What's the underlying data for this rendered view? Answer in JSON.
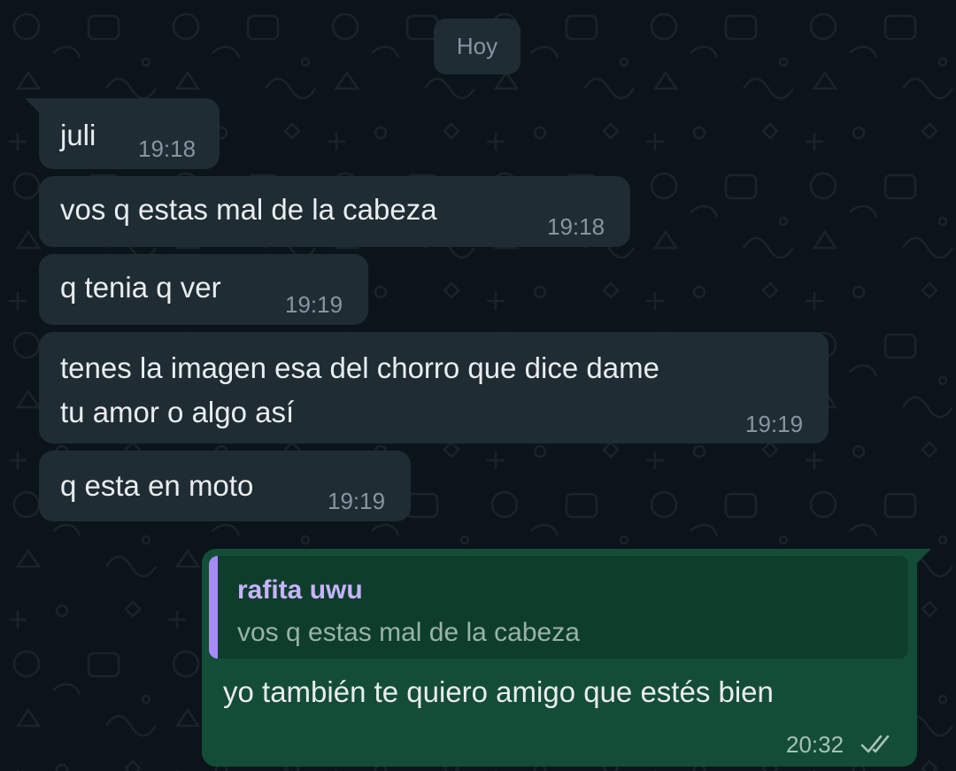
{
  "date_chip": "Hoy",
  "incoming": [
    {
      "text": "juli",
      "time": "19:18"
    },
    {
      "text": "vos q estas mal de la cabeza",
      "time": "19:18"
    },
    {
      "text": "q tenia q ver",
      "time": "19:19"
    },
    {
      "text": "tenes la imagen esa del chorro que dice dame\ntu amor o algo así",
      "time": "19:19"
    },
    {
      "text": "q esta en moto",
      "time": "19:19"
    }
  ],
  "outgoing": {
    "quote_author": "rafita uwu",
    "quote_text": "vos q estas mal de la cabeza",
    "text": "yo también te quiero amigo que estés bien",
    "time": "20:32",
    "status_icon": "double-check-icon"
  },
  "colors": {
    "background": "#0b141a",
    "incoming_bubble": "#1f2c34",
    "outgoing_bubble": "#144d37",
    "quote_accent": "#a78bfa"
  }
}
